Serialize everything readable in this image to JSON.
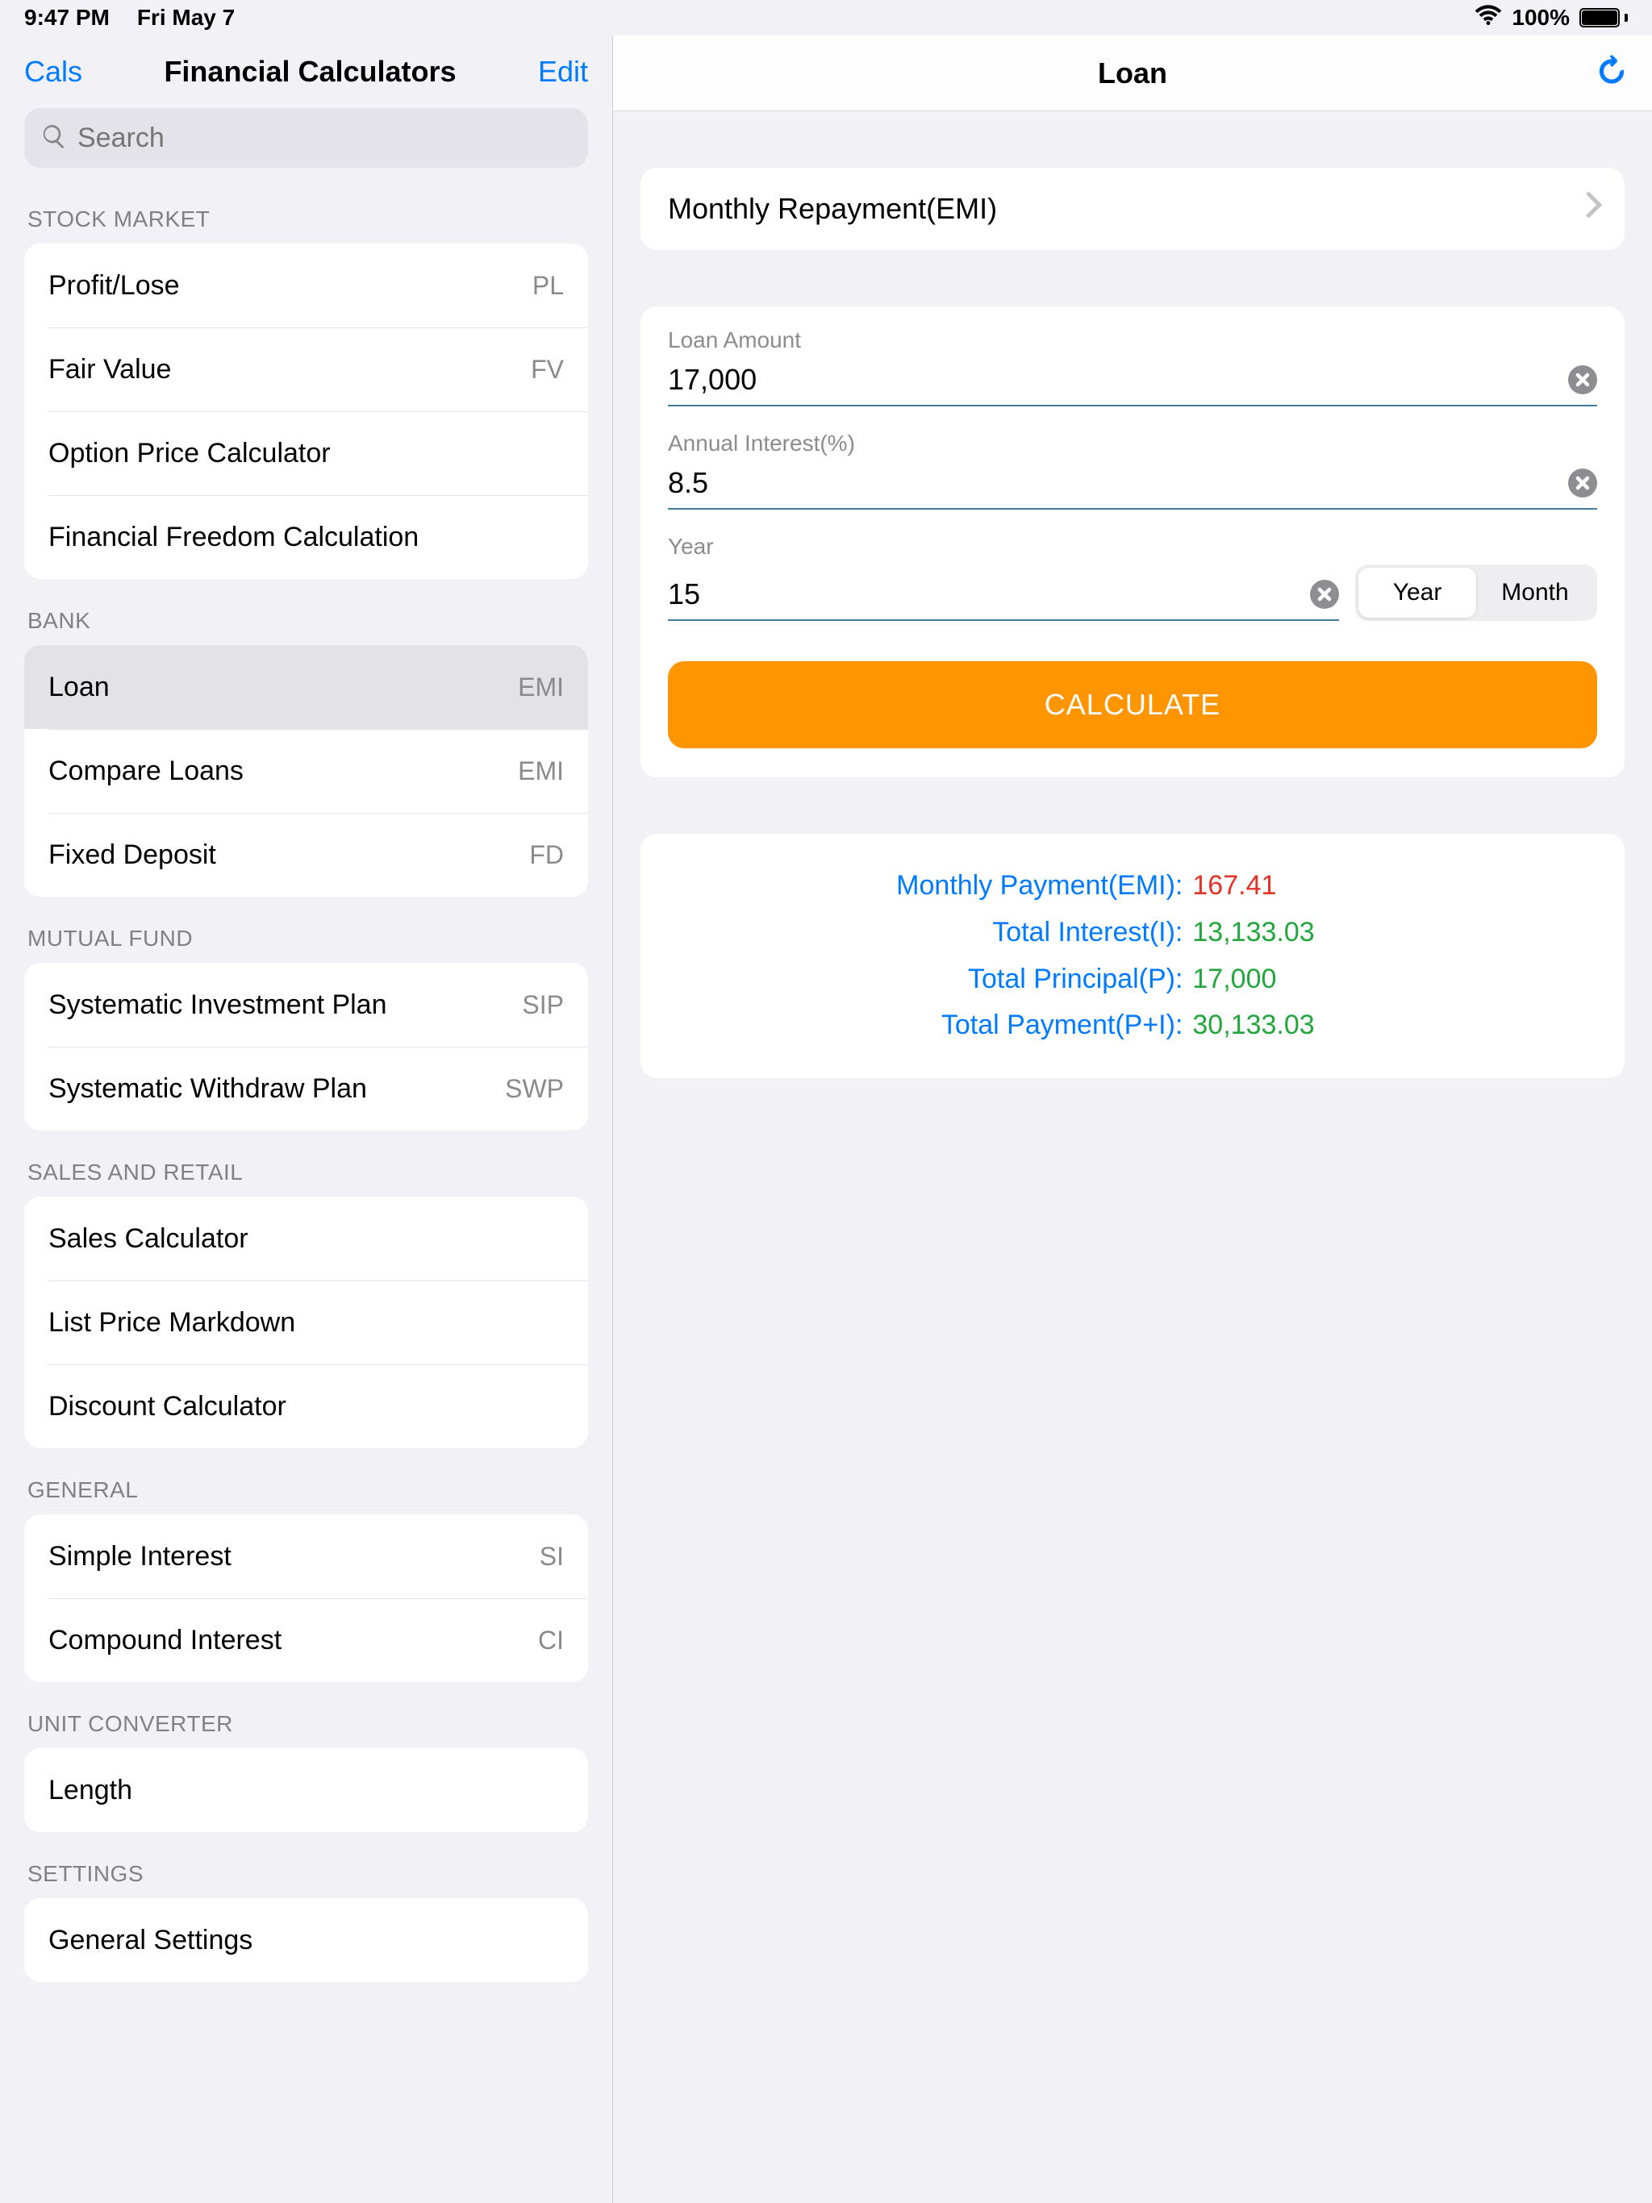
{
  "status": {
    "time": "9:47 PM",
    "date": "Fri May 7",
    "battery": "100%"
  },
  "sidebar": {
    "back_label": "Cals",
    "title": "Financial Calculators",
    "edit_label": "Edit",
    "search_placeholder": "Search",
    "sections": [
      {
        "header": "STOCK MARKET",
        "items": [
          {
            "label": "Profit/Lose",
            "badge": "PL"
          },
          {
            "label": "Fair Value",
            "badge": "FV"
          },
          {
            "label": "Option Price Calculator",
            "badge": ""
          },
          {
            "label": "Financial Freedom Calculation",
            "badge": ""
          }
        ]
      },
      {
        "header": "BANK",
        "items": [
          {
            "label": "Loan",
            "badge": "EMI",
            "selected": true
          },
          {
            "label": "Compare Loans",
            "badge": "EMI"
          },
          {
            "label": "Fixed Deposit",
            "badge": "FD"
          }
        ]
      },
      {
        "header": "MUTUAL FUND",
        "items": [
          {
            "label": "Systematic Investment Plan",
            "badge": "SIP"
          },
          {
            "label": "Systematic Withdraw Plan",
            "badge": "SWP"
          }
        ]
      },
      {
        "header": "SALES AND RETAIL",
        "items": [
          {
            "label": "Sales Calculator",
            "badge": ""
          },
          {
            "label": "List Price Markdown",
            "badge": ""
          },
          {
            "label": "Discount Calculator",
            "badge": ""
          }
        ]
      },
      {
        "header": "GENERAL",
        "items": [
          {
            "label": "Simple Interest",
            "badge": "SI"
          },
          {
            "label": "Compound Interest",
            "badge": "CI"
          }
        ]
      },
      {
        "header": "UNIT CONVERTER",
        "items": [
          {
            "label": "Length",
            "badge": ""
          }
        ]
      },
      {
        "header": "SETTINGS",
        "items": [
          {
            "label": "General Settings",
            "badge": ""
          }
        ]
      }
    ]
  },
  "main": {
    "title": "Loan",
    "emi_mode": "Monthly Repayment(EMI)",
    "fields": {
      "amount_label": "Loan Amount",
      "amount_value": "17,000",
      "interest_label": "Annual Interest(%)",
      "interest_value": "8.5",
      "term_label": "Year",
      "term_value": "15",
      "unit_year": "Year",
      "unit_month": "Month"
    },
    "calculate_label": "CALCULATE",
    "results": {
      "monthly_label": "Monthly Payment(EMI):",
      "monthly_value": "167.41",
      "interest_label": "Total Interest(I):",
      "interest_value": "13,133.03",
      "principal_label": "Total Principal(P):",
      "principal_value": "17,000",
      "total_label": "Total Payment(P+I):",
      "total_value": "30,133.03"
    }
  }
}
